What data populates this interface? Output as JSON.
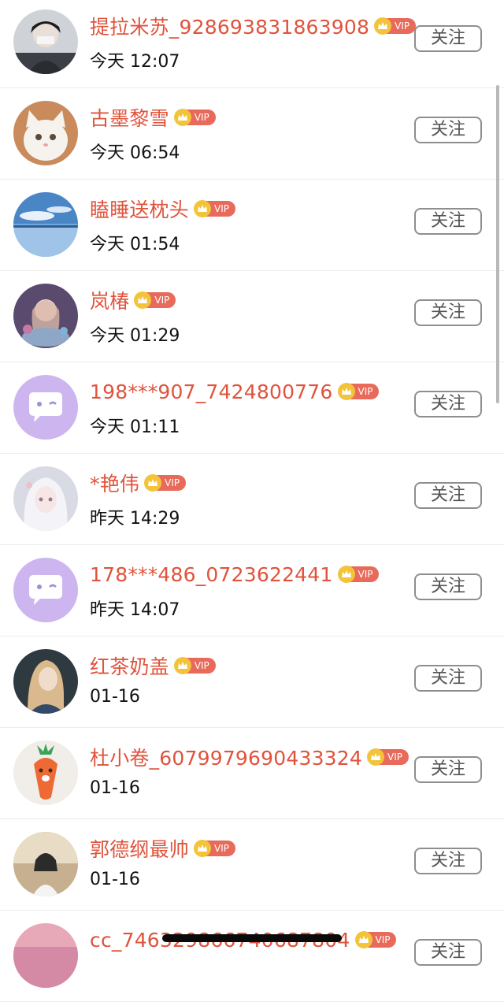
{
  "follow_label": "关注",
  "vip_label": "VIP",
  "colors": {
    "name": "#e0533c",
    "vip_badge": "#e86a5b",
    "crown": "#f3c43a"
  },
  "rows": [
    {
      "name": "提拉米苏_928693831863908",
      "time": "今天 12:07",
      "avatar": "photo-person-avatar"
    },
    {
      "name": "古墨黎雪",
      "time": "今天 06:54",
      "avatar": "white-cat-avatar"
    },
    {
      "name": "瞌睡送枕头",
      "time": "今天 01:54",
      "avatar": "blue-sky-landscape-avatar"
    },
    {
      "name": "岚椿",
      "time": "今天 01:29",
      "avatar": "anime-girl-avatar"
    },
    {
      "name": "198***907_7424800776",
      "time": "今天 01:11",
      "avatar": "default-chat-bubble-avatar"
    },
    {
      "name": "*艳伟",
      "time": "昨天 14:29",
      "avatar": "anime-white-hair-avatar"
    },
    {
      "name": "178***486_0723622441",
      "time": "昨天 14:07",
      "avatar": "default-chat-bubble-avatar"
    },
    {
      "name": "红茶奶盖",
      "time": "01-16",
      "avatar": "portrait-girl-avatar"
    },
    {
      "name": "杜小卷_6079979690433324",
      "time": "01-16",
      "avatar": "carrot-cartoon-avatar"
    },
    {
      "name": "郭德纲最帅",
      "time": "01-16",
      "avatar": "outdoor-girl-avatar"
    },
    {
      "name": "cc_74632986674068780​4",
      "time": "",
      "avatar": "pink-sky-avatar"
    }
  ]
}
